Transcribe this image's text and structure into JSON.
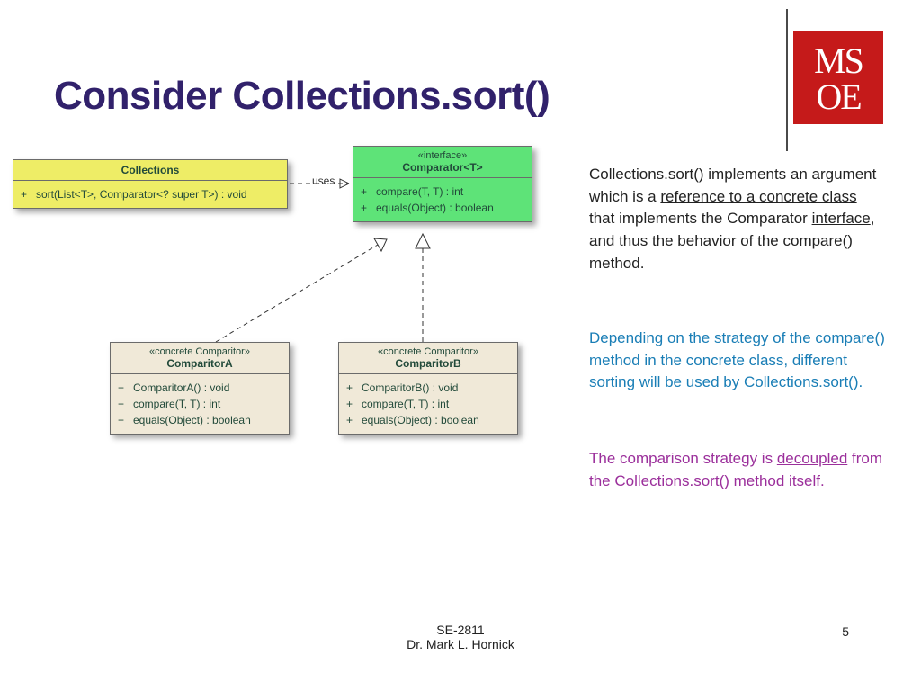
{
  "title": "Consider Collections.sort()",
  "logo": {
    "line1": "MS",
    "line2": "OE"
  },
  "uml": {
    "collections": {
      "name": "Collections",
      "ops": "+   sort(List<T>, Comparator<? super T>) : void"
    },
    "comparator": {
      "stereo": "«interface»",
      "name": "Comparator<T>",
      "ops": "+   compare(T, T) : int\n+   equals(Object) : boolean"
    },
    "compA": {
      "stereo": "«concrete Comparitor»",
      "name": "ComparitorA",
      "ops": "+   ComparitorA() : void\n+   compare(T, T) : int\n+   equals(Object) : boolean"
    },
    "compB": {
      "stereo": "«concrete Comparitor»",
      "name": "ComparitorB",
      "ops": "+   ComparitorB() : void\n+   compare(T, T) : int\n+   equals(Object) : boolean"
    },
    "uses_label": "uses"
  },
  "para1": {
    "t1": "Collections.sort() implements an argument which is a ",
    "u1": "reference to a concrete class",
    "t2": " that implements the Comparator ",
    "u2": "interface",
    "t3": ", and thus the behavior of the compare() method."
  },
  "para2": "Depending on the strategy of the compare() method in the  concrete class, different sorting will be used by Collections.sort().",
  "para3": {
    "t1": "The comparison strategy is ",
    "u1": "decoupled",
    "t2": " from the Collections.sort() method itself."
  },
  "footer": {
    "course": "SE-2811",
    "author": "Dr. Mark L. Hornick",
    "page": "5"
  }
}
